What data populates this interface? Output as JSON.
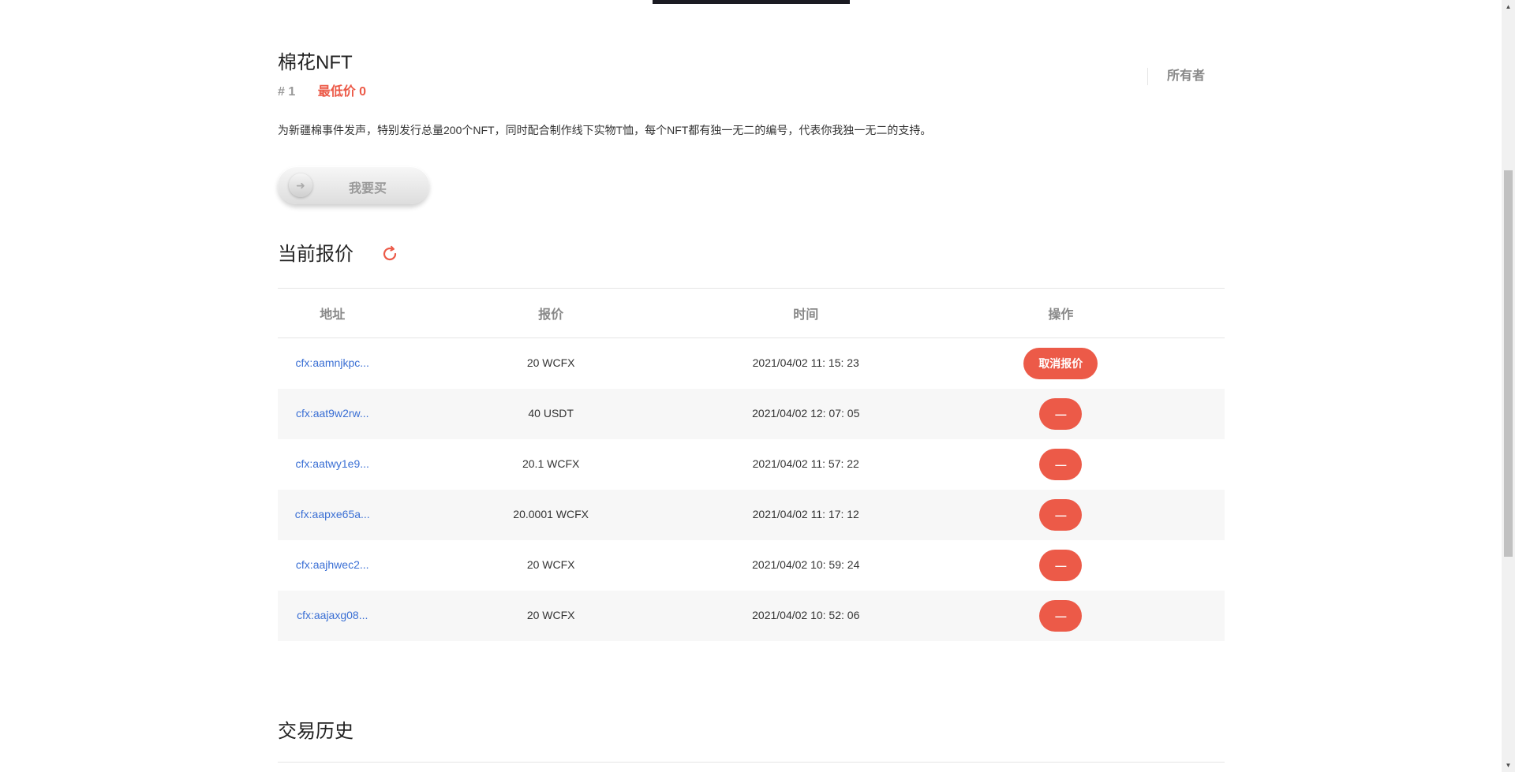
{
  "nft": {
    "title": "棉花NFT",
    "number": "# 1",
    "lowest_price": "最低价 0",
    "owner_label": "所有者",
    "description": "为新疆棉事件发声，特别发行总量200个NFT，同时配合制作线下实物T恤，每个NFT都有独一无二的编号，代表你我独一无二的支持。",
    "buy_label": "我要买"
  },
  "offers": {
    "title": "当前报价",
    "headers": [
      "地址",
      "报价",
      "时间",
      "操作"
    ],
    "rows": [
      {
        "address": "cfx:aamnjkpc...",
        "price": "20 WCFX",
        "time": "2021/04/02 11: 15: 23",
        "action": "取消报价"
      },
      {
        "address": "cfx:aat9w2rw...",
        "price": "40 USDT",
        "time": "2021/04/02 12: 07: 05",
        "action": "—"
      },
      {
        "address": "cfx:aatwy1e9...",
        "price": "20.1 WCFX",
        "time": "2021/04/02 11: 57: 22",
        "action": "—"
      },
      {
        "address": "cfx:aapxe65a...",
        "price": "20.0001 WCFX",
        "time": "2021/04/02 11: 17: 12",
        "action": "—"
      },
      {
        "address": "cfx:aajhwec2...",
        "price": "20 WCFX",
        "time": "2021/04/02 10: 59: 24",
        "action": "—"
      },
      {
        "address": "cfx:aajaxg08...",
        "price": "20 WCFX",
        "time": "2021/04/02 10: 52: 06",
        "action": "—"
      }
    ]
  },
  "history": {
    "title": "交易历史"
  },
  "colors": {
    "accent": "#ec5a48",
    "link": "#3a6fd4"
  }
}
